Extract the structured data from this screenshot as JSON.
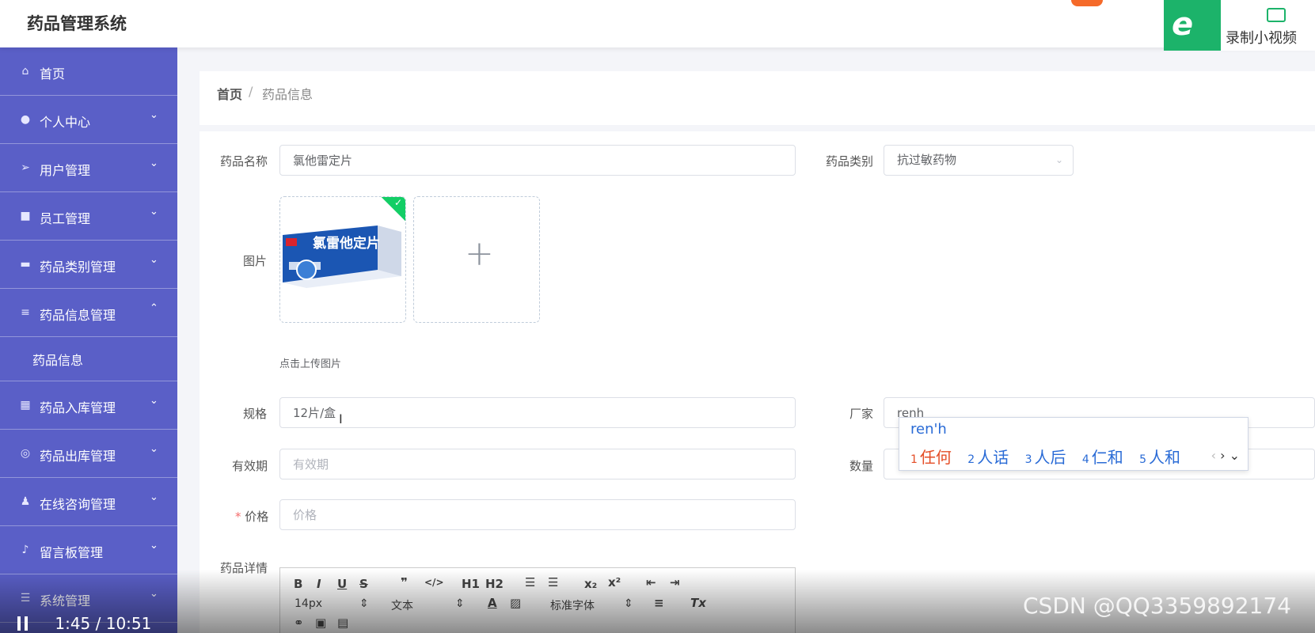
{
  "app": {
    "title": "药品管理系统"
  },
  "recorder": {
    "label": "录制小视频",
    "icon": "video-camera-icon"
  },
  "sidebar": {
    "items": [
      {
        "label": "首页",
        "icon": "home-icon",
        "chevron": ""
      },
      {
        "label": "个人中心",
        "icon": "user-icon",
        "chevron": "⌄"
      },
      {
        "label": "用户管理",
        "icon": "send-icon",
        "chevron": "⌄"
      },
      {
        "label": "员工管理",
        "icon": "suitcase-icon",
        "chevron": "⌄"
      },
      {
        "label": "药品类别管理",
        "icon": "chat-icon",
        "chevron": "⌄"
      },
      {
        "label": "药品信息管理",
        "icon": "sliders-icon",
        "chevron": "⌃"
      },
      {
        "label": "药品入库管理",
        "icon": "grid-icon",
        "chevron": "⌄"
      },
      {
        "label": "药品出库管理",
        "icon": "globe-icon",
        "chevron": "⌄"
      },
      {
        "label": "在线咨询管理",
        "icon": "user-solid-icon",
        "chevron": "⌄"
      },
      {
        "label": "留言板管理",
        "icon": "microphone-icon",
        "chevron": "⌄"
      },
      {
        "label": "系统管理",
        "icon": "list-icon",
        "chevron": "⌄"
      }
    ],
    "sub_item": "药品信息"
  },
  "breadcrumb": {
    "home": "首页",
    "sep": "/",
    "current": "药品信息"
  },
  "form": {
    "name_label": "药品名称",
    "name_value": "氯他雷定片",
    "category_label": "药品类别",
    "category_value": "抗过敏药物",
    "image_label": "图片",
    "upload_tip": "点击上传图片",
    "spec_label": "规格",
    "spec_value": "12片/盒",
    "maker_label": "厂家",
    "maker_value": "renh",
    "expiry_label": "有效期",
    "expiry_placeholder": "有效期",
    "qty_label": "数量",
    "price_label": "价格",
    "price_placeholder": "价格",
    "details_label": "药品详情",
    "box_text": "氯雷他定片"
  },
  "ime": {
    "composition": "ren'h",
    "candidates": [
      {
        "num": "1",
        "text": "任何"
      },
      {
        "num": "2",
        "text": "人话"
      },
      {
        "num": "3",
        "text": "人后"
      },
      {
        "num": "4",
        "text": "仁和"
      },
      {
        "num": "5",
        "text": "人和"
      }
    ]
  },
  "editor": {
    "font_size": "14px",
    "text_style": "文本",
    "font_family": "标准字体"
  },
  "player": {
    "time": "1:45 / 10:51"
  },
  "watermark": "CSDN @QQ3359892174",
  "colors": {
    "sidebar": "#5a5fc7",
    "accent": "#1cb36a",
    "required": "#f56c6c"
  }
}
